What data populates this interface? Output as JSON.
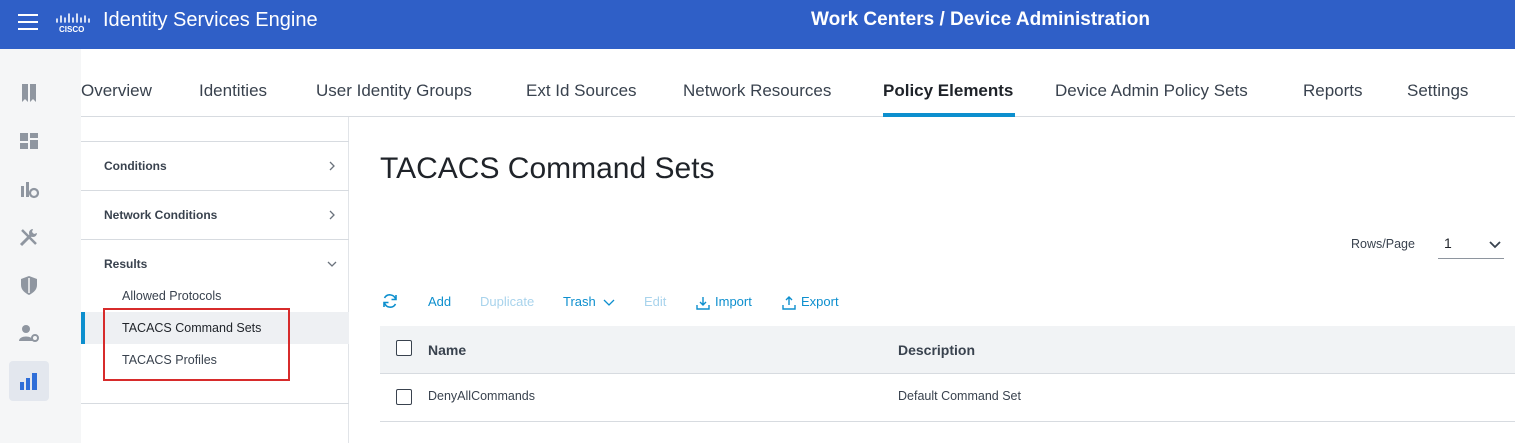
{
  "header": {
    "app_title": "Identity Services Engine",
    "page_heading": "Work Centers / Device Administration",
    "bg_color": "#2f5fc7"
  },
  "rail": {
    "icons": [
      "bookmark-icon",
      "dashboard-icon",
      "context-visibility-icon",
      "operations-icon",
      "policy-icon",
      "administration-icon",
      "work-centers-icon"
    ],
    "active_index": 6
  },
  "tabs": [
    {
      "label": "Overview"
    },
    {
      "label": "Identities"
    },
    {
      "label": "User Identity Groups"
    },
    {
      "label": "Ext Id Sources"
    },
    {
      "label": "Network Resources"
    },
    {
      "label": "Policy Elements"
    },
    {
      "label": "Device Admin Policy Sets"
    },
    {
      "label": "Reports"
    },
    {
      "label": "Settings"
    }
  ],
  "active_tab": "Policy Elements",
  "side": {
    "sections": [
      {
        "label": "Conditions",
        "expanded": false
      },
      {
        "label": "Network Conditions",
        "expanded": false
      },
      {
        "label": "Results",
        "expanded": true
      }
    ],
    "results_items": [
      {
        "label": "Allowed Protocols"
      },
      {
        "label": "TACACS Command Sets"
      },
      {
        "label": "TACACS Profiles"
      }
    ],
    "selected_item": "TACACS Command Sets"
  },
  "main": {
    "title": "TACACS Command Sets",
    "rows_per_page_label": "Rows/Page",
    "rows_per_page_value": "1"
  },
  "toolbar": {
    "add": "Add",
    "duplicate": "Duplicate",
    "trash": "Trash",
    "edit": "Edit",
    "import": "Import",
    "export": "Export"
  },
  "table": {
    "columns": [
      "Name",
      "Description"
    ],
    "rows": [
      {
        "name": "DenyAllCommands",
        "description": "Default Command Set"
      }
    ]
  },
  "colors": {
    "accent": "#0d8fce",
    "highlight_box": "#d72b2b"
  }
}
